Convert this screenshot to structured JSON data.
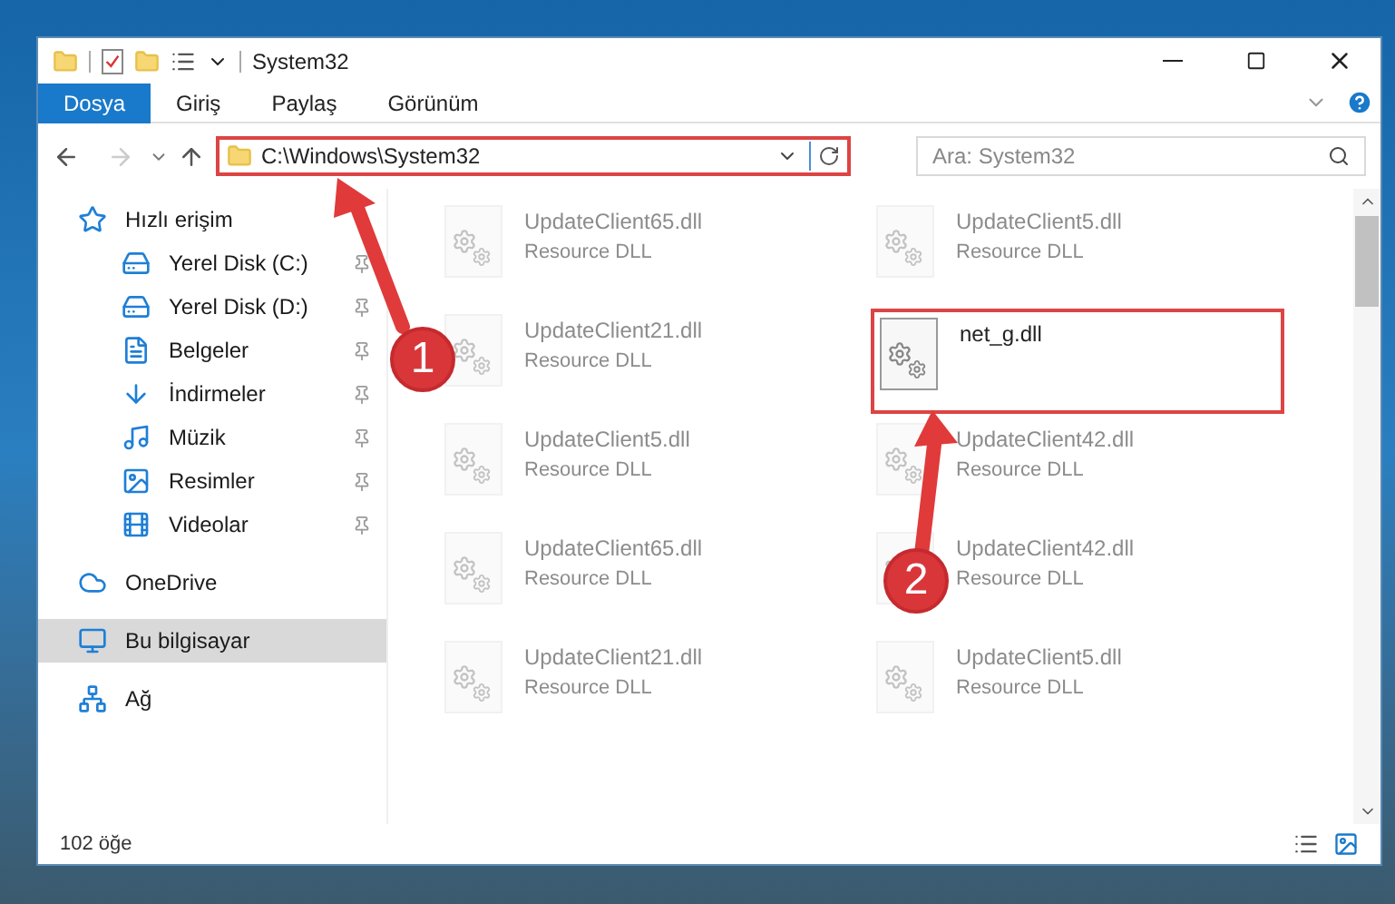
{
  "window": {
    "title": "System32"
  },
  "ribbon_tabs": [
    {
      "label": "Dosya",
      "selected": true
    },
    {
      "label": "Giriş",
      "selected": false
    },
    {
      "label": "Paylaş",
      "selected": false
    },
    {
      "label": "Görünüm",
      "selected": false
    }
  ],
  "address": {
    "value": "C:\\Windows\\System32"
  },
  "search": {
    "placeholder": "Ara: System32"
  },
  "sidebar": {
    "items": [
      {
        "label": "Hızlı erişim",
        "kind": "star",
        "selected": false,
        "children": [
          {
            "label": "Yerel Disk (C:)",
            "kind": "system-drive",
            "pinned": true,
            "selected": false
          },
          {
            "label": "Yerel Disk (D:)",
            "kind": "drive",
            "pinned": true,
            "selected": false
          },
          {
            "label": "Belgeler",
            "kind": "documents",
            "pinned": true,
            "selected": false
          },
          {
            "label": "İndirmeler",
            "kind": "downloads",
            "pinned": true,
            "selected": false
          },
          {
            "label": "Müzik",
            "kind": "music",
            "pinned": true,
            "selected": false
          },
          {
            "label": "Resimler",
            "kind": "pictures",
            "pinned": true,
            "selected": false
          },
          {
            "label": "Videolar",
            "kind": "videos",
            "pinned": true,
            "selected": false
          }
        ]
      },
      {
        "label": "OneDrive",
        "kind": "cloud",
        "selected": false
      },
      {
        "label": "Bu bilgisayar",
        "kind": "computer",
        "selected": true
      },
      {
        "label": "Ağ",
        "kind": "network",
        "selected": false
      }
    ]
  },
  "files": [
    {
      "name": "UpdateClient65.dll",
      "type": "Resource DLL",
      "faded": true
    },
    {
      "name": "UpdateClient5.dll",
      "type": "Resource DLL",
      "faded": true
    },
    {
      "name": "UpdateClient21.dll",
      "type": "Resource DLL",
      "faded": true
    },
    {
      "name": "net_g.dll",
      "faded": false
    },
    {
      "name": "UpdateClient5.dll",
      "type": "Resource DLL",
      "faded": true
    },
    {
      "name": "UpdateClient42.dll",
      "type": "Resource DLL",
      "faded": true
    },
    {
      "name": "UpdateClient65.dll",
      "type": "Resource DLL",
      "faded": true
    },
    {
      "name": "UpdateClient42.dll",
      "type": "Resource DLL",
      "faded": true
    },
    {
      "name": "UpdateClient21.dll",
      "type": "Resource DLL",
      "faded": true
    },
    {
      "name": "UpdateClient5.dll",
      "type": "Resource DLL",
      "faded": true
    }
  ],
  "status_bar": {
    "count": "102 öğe"
  },
  "annotations": [
    {
      "number": "1"
    },
    {
      "number": "2"
    }
  ]
}
